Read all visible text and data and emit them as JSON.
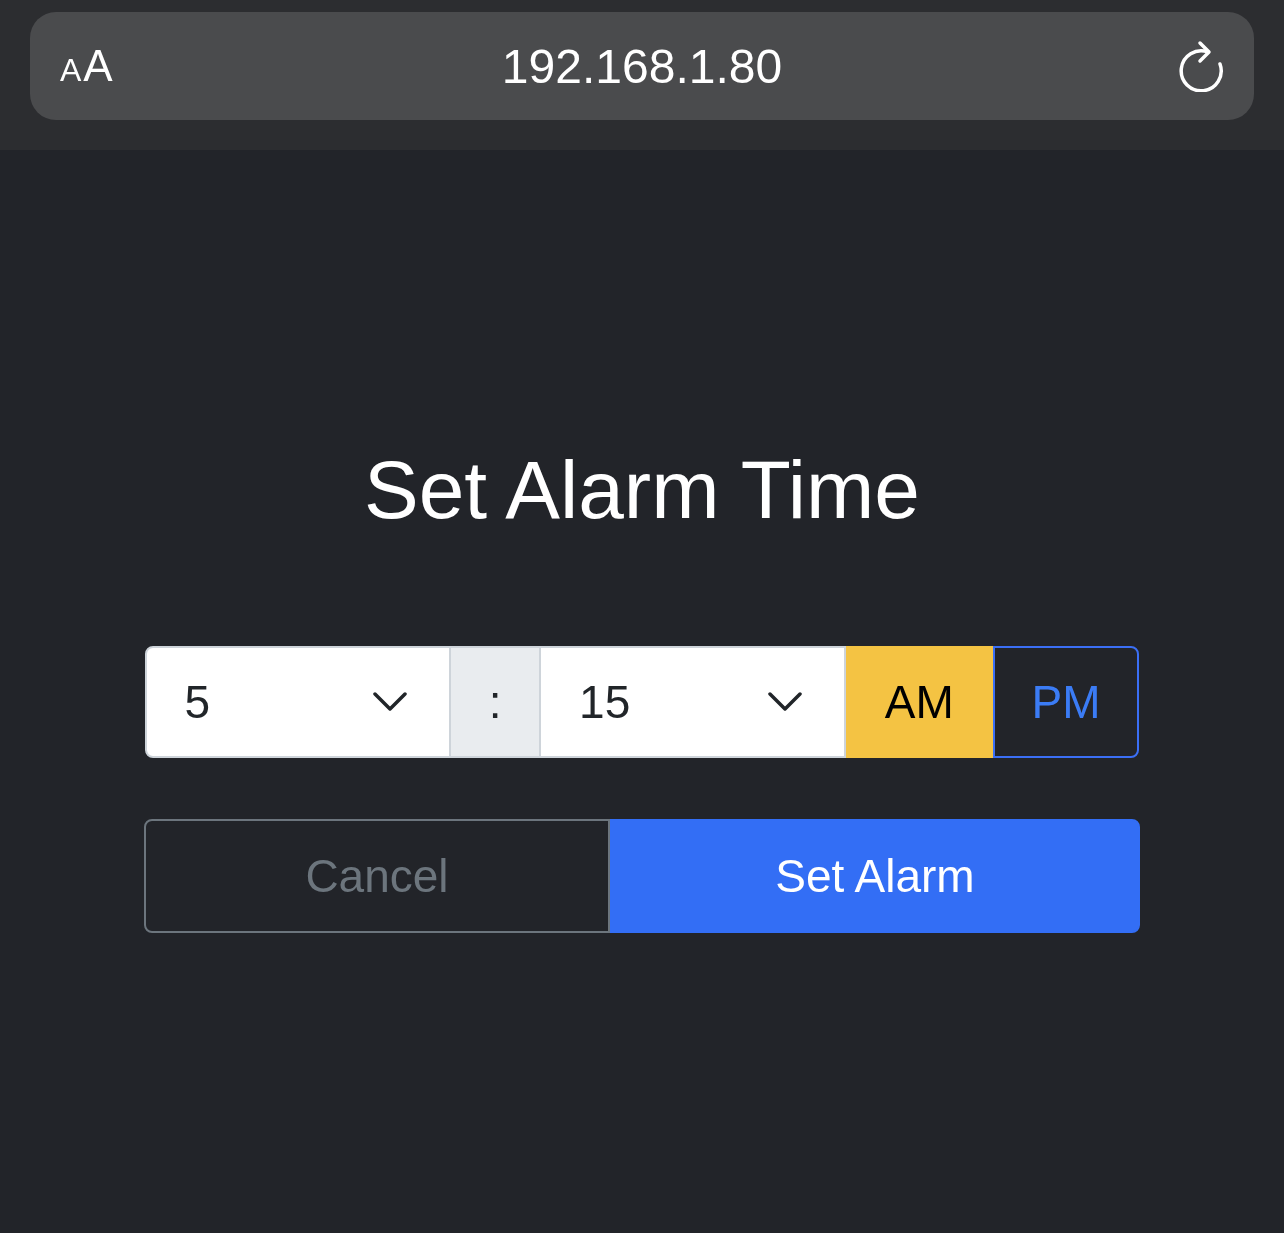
{
  "address_bar": {
    "text_size_button": "AA",
    "url": "192.168.1.80"
  },
  "title": "Set Alarm Time",
  "time": {
    "hour": "5",
    "separator": ":",
    "minute": "15"
  },
  "periods": [
    {
      "label": "AM",
      "selected": true
    },
    {
      "label": "PM",
      "selected": false
    }
  ],
  "buttons": [
    {
      "label": "Cancel",
      "kind": "secondary"
    },
    {
      "label": "Set Alarm",
      "kind": "primary"
    }
  ]
}
